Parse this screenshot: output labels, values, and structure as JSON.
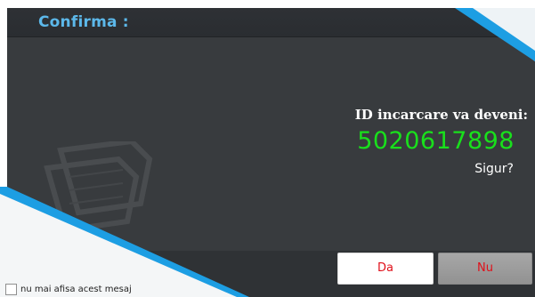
{
  "dialog": {
    "title": "Confirma :",
    "message_title": "ID incarcare va deveni:",
    "message_id": "5020617898",
    "message_question": "Sigur?"
  },
  "buttons": {
    "yes_label": "Da",
    "no_label": "Nu"
  },
  "checkbox": {
    "label": "nu mai afisa acest mesaj",
    "checked": false
  },
  "colors": {
    "title": "#5cb8ea",
    "id": "#19e01c",
    "button_text": "#e0101a",
    "accent_blue": "#1d9ee3"
  },
  "icons": {
    "watermark": "document-stack-icon"
  }
}
